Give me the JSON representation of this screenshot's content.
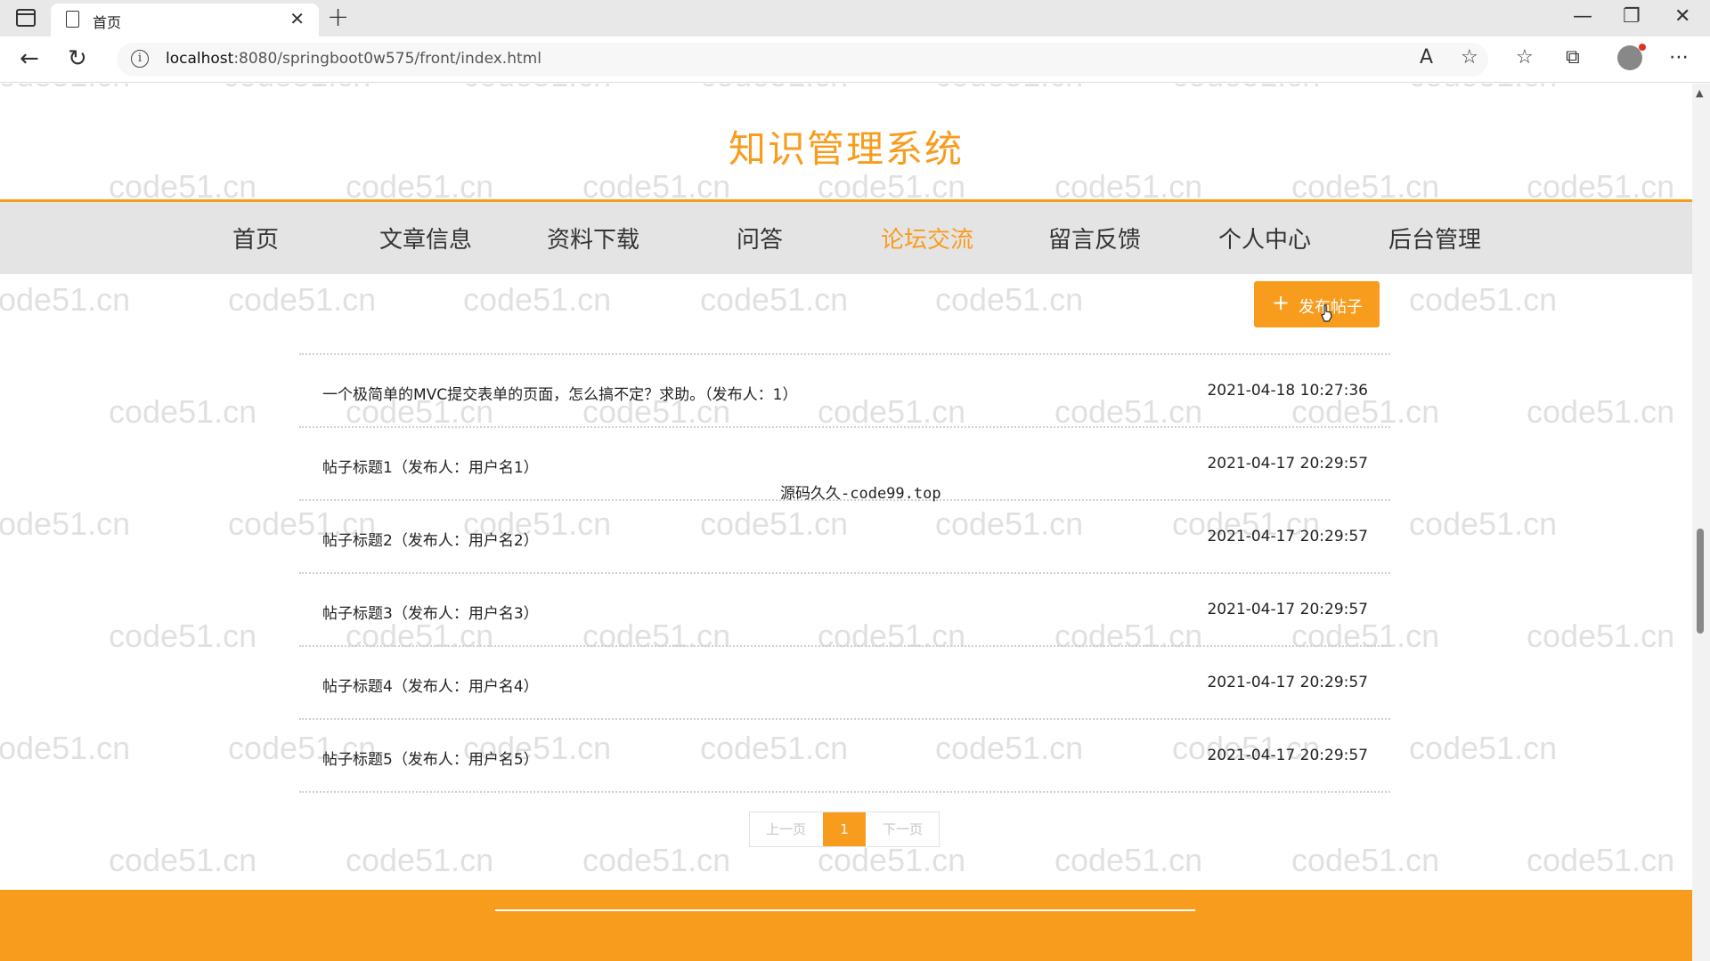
{
  "browser": {
    "tab_title": "首页",
    "url_host": "localhost",
    "url_rest": ":8080/springboot0w575/front/index.html"
  },
  "site": {
    "title": "知识管理系统"
  },
  "nav": [
    {
      "label": "首页",
      "active": false
    },
    {
      "label": "文章信息",
      "active": false
    },
    {
      "label": "资料下载",
      "active": false
    },
    {
      "label": "问答",
      "active": false
    },
    {
      "label": "论坛交流",
      "active": true
    },
    {
      "label": "留言反馈",
      "active": false
    },
    {
      "label": "个人中心",
      "active": false
    },
    {
      "label": "后台管理",
      "active": false
    }
  ],
  "actions": {
    "post_button_label": "发布帖子"
  },
  "posts": [
    {
      "title": "一个极简单的MVC提交表单的页面，怎么搞不定？求助。（发布人：1）",
      "date": "2021-04-18 10:27:36"
    },
    {
      "title": "帖子标题1（发布人：用户名1）",
      "date": "2021-04-17 20:29:57"
    },
    {
      "title": "帖子标题2（发布人：用户名2）",
      "date": "2021-04-17 20:29:57"
    },
    {
      "title": "帖子标题3（发布人：用户名3）",
      "date": "2021-04-17 20:29:57"
    },
    {
      "title": "帖子标题4（发布人：用户名4）",
      "date": "2021-04-17 20:29:57"
    },
    {
      "title": "帖子标题5（发布人：用户名5）",
      "date": "2021-04-17 20:29:57"
    }
  ],
  "pagination": {
    "prev": "上一页",
    "current": "1",
    "next": "下一页"
  },
  "watermarks": {
    "center": "源码久久-code99.top",
    "tile": "code51.cn"
  },
  "colors": {
    "accent": "#f89c1e",
    "nav_bg": "#e4e4e4"
  }
}
